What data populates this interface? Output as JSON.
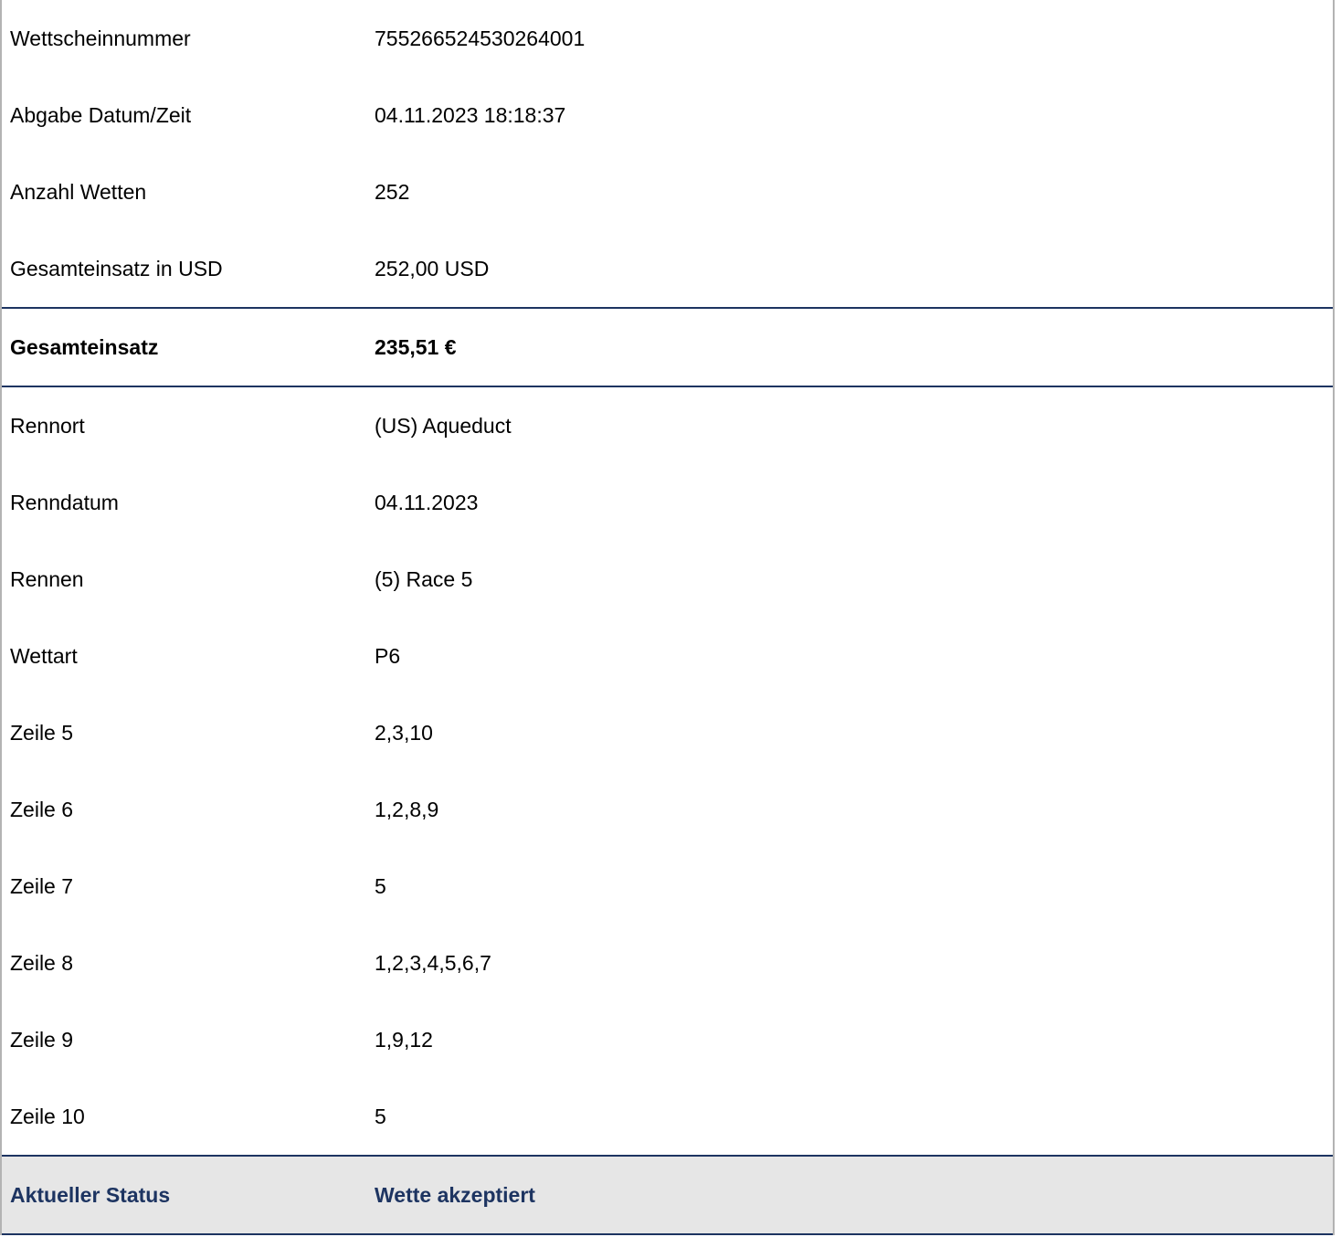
{
  "colors": {
    "accent": "#1d3461",
    "status_background": "#e6e6e6",
    "frame_border": "#b3b3b3"
  },
  "top_rows": [
    {
      "label": "Wettscheinnummer",
      "value": "755266524530264001"
    },
    {
      "label": "Abgabe Datum/Zeit",
      "value": "04.11.2023 18:18:37"
    },
    {
      "label": "Anzahl Wetten",
      "value": "252"
    },
    {
      "label": "Gesamteinsatz in USD",
      "value": "252,00 USD"
    }
  ],
  "total": {
    "label": "Gesamteinsatz",
    "value": "235,51 €"
  },
  "detail_rows": [
    {
      "label": "Rennort",
      "value": "(US) Aqueduct"
    },
    {
      "label": "Renndatum",
      "value": "04.11.2023"
    },
    {
      "label": "Rennen",
      "value": "(5) Race 5"
    },
    {
      "label": "Wettart",
      "value": "P6"
    },
    {
      "label": "Zeile 5",
      "value": "2,3,10"
    },
    {
      "label": "Zeile 6",
      "value": "1,2,8,9"
    },
    {
      "label": "Zeile 7",
      "value": "5"
    },
    {
      "label": "Zeile 8",
      "value": "1,2,3,4,5,6,7"
    },
    {
      "label": "Zeile 9",
      "value": "1,9,12"
    },
    {
      "label": "Zeile 10",
      "value": "5"
    }
  ],
  "status": {
    "label": "Aktueller Status",
    "value": "Wette akzeptiert"
  }
}
